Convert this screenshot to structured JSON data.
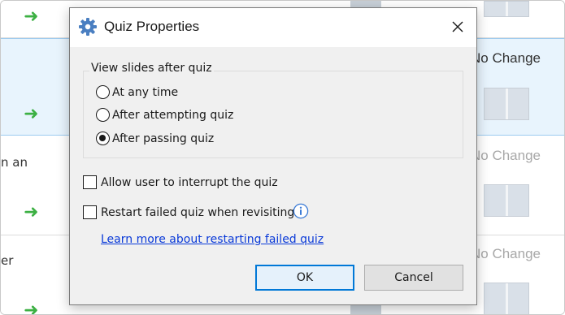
{
  "background": {
    "rows": [
      {
        "left_text": "",
        "right_text": ""
      },
      {
        "left_text": "",
        "right_text": "No Change"
      },
      {
        "left_text": "n an",
        "right_text": "No Change"
      },
      {
        "left_text": "er",
        "right_text": "No Change"
      }
    ],
    "arrow_glyph": "➜"
  },
  "dialog": {
    "title": "Quiz Properties",
    "title_icon": "gear-icon",
    "close_icon": "close-icon",
    "group_label": "View slides after quiz",
    "radio_options": [
      {
        "label": "At any time",
        "checked": false
      },
      {
        "label": "After attempting quiz",
        "checked": false
      },
      {
        "label": "After passing quiz",
        "checked": true
      }
    ],
    "checkboxes": [
      {
        "label": "Allow user to interrupt the quiz",
        "checked": false
      },
      {
        "label": "Restart failed quiz when revisiting",
        "checked": false
      }
    ],
    "info_icon": "info-icon",
    "link_text": "Learn more about restarting failed quiz",
    "ok_label": "OK",
    "cancel_label": "Cancel"
  },
  "colors": {
    "accent": "#0078d7",
    "arrow": "#3cb043",
    "link": "#0a3ad8",
    "selected_row": "#e8f4fd"
  }
}
